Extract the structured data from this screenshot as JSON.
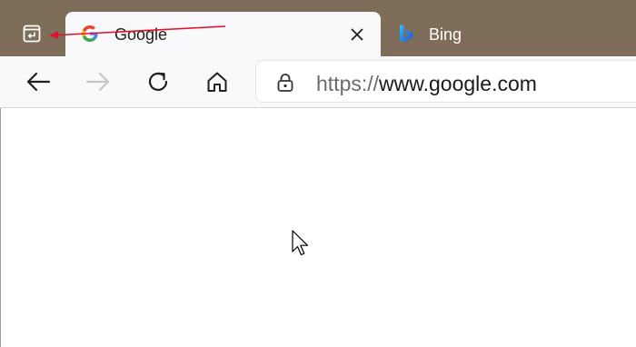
{
  "colors": {
    "tabstrip_bg": "#7e6d59",
    "toolbar_bg": "#f9f9fb",
    "annotation_arrow": "#e0102a"
  },
  "tabstrip": {
    "actions_icon": "tab-actions-icon",
    "tabs": [
      {
        "title": "Google",
        "icon": "google-g-icon",
        "active": true,
        "close_icon": "close-icon"
      },
      {
        "title": "Bing",
        "icon": "bing-logo-icon",
        "active": false
      }
    ]
  },
  "toolbar": {
    "back_icon": "arrow-left-icon",
    "forward_icon": "arrow-right-icon",
    "refresh_icon": "refresh-icon",
    "home_icon": "home-icon",
    "address": {
      "lock_icon": "lock-icon",
      "scheme": "https://",
      "host": "www.google.com"
    }
  }
}
